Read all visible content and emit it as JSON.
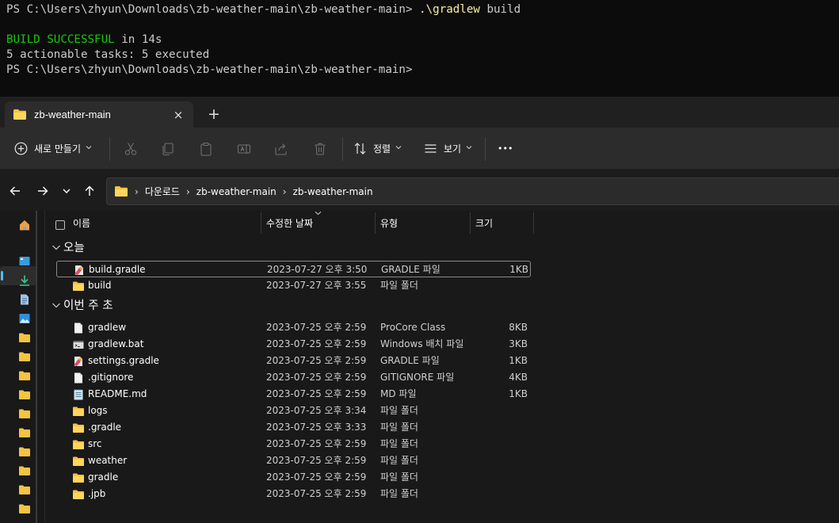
{
  "terminal": {
    "lines": {
      "l1_prompt": "PS C:\\Users\\zhyun\\Downloads\\zb-weather-main\\zb-weather-main> ",
      "l1_cmd": ".\\gradlew",
      "l1_arg": " build",
      "l3_ok": "BUILD SUCCESSFUL",
      "l3_rest": " in 14s",
      "l4": "5 actionable tasks: 5 executed",
      "l5": "PS C:\\Users\\zhyun\\Downloads\\zb-weather-main\\zb-weather-main>"
    }
  },
  "tab": {
    "title": "zb-weather-main",
    "close_icon": "×",
    "new_icon": "+"
  },
  "toolbar": {
    "new_label": "새로 만들기",
    "sort_label": "정렬",
    "view_label": "보기",
    "more_label": "•••",
    "chevron": "⌄"
  },
  "address": {
    "crumbs": [
      "다운로드",
      "zb-weather-main",
      "zb-weather-main"
    ],
    "sep": "›"
  },
  "columns": {
    "name": "이름",
    "date": "수정한 날짜",
    "type": "유형",
    "size": "크기"
  },
  "groups": [
    {
      "title": "오늘",
      "items": [
        {
          "name": "build.gradle",
          "date": "2023-07-27 오후 3:50",
          "type": "GRADLE 파일",
          "size": "1KB",
          "icon": "gradle-file-icon",
          "selected": true
        },
        {
          "name": "build",
          "date": "2023-07-27 오후 3:55",
          "type": "파일 폴더",
          "size": "",
          "icon": "folder-icon"
        }
      ]
    },
    {
      "title": "이번 주 초",
      "items": [
        {
          "name": "gradlew",
          "date": "2023-07-25 오후 2:59",
          "type": "ProCore Class",
          "size": "8KB",
          "icon": "file-icon"
        },
        {
          "name": "gradlew.bat",
          "date": "2023-07-25 오후 2:59",
          "type": "Windows 배치 파일",
          "size": "3KB",
          "icon": "batch-file-icon"
        },
        {
          "name": "settings.gradle",
          "date": "2023-07-25 오후 2:59",
          "type": "GRADLE 파일",
          "size": "1KB",
          "icon": "gradle-file-icon"
        },
        {
          "name": ".gitignore",
          "date": "2023-07-25 오후 2:59",
          "type": "GITIGNORE 파일",
          "size": "4KB",
          "icon": "file-icon"
        },
        {
          "name": "README.md",
          "date": "2023-07-25 오후 2:59",
          "type": "MD 파일",
          "size": "1KB",
          "icon": "notepad-file-icon"
        },
        {
          "name": "logs",
          "date": "2023-07-25 오후 3:34",
          "type": "파일 폴더",
          "size": "",
          "icon": "folder-icon"
        },
        {
          "name": ".gradle",
          "date": "2023-07-25 오후 3:33",
          "type": "파일 폴더",
          "size": "",
          "icon": "folder-icon"
        },
        {
          "name": "src",
          "date": "2023-07-25 오후 2:59",
          "type": "파일 폴더",
          "size": "",
          "icon": "folder-icon"
        },
        {
          "name": "weather",
          "date": "2023-07-25 오후 2:59",
          "type": "파일 폴더",
          "size": "",
          "icon": "folder-icon"
        },
        {
          "name": "gradle",
          "date": "2023-07-25 오후 2:59",
          "type": "파일 폴더",
          "size": "",
          "icon": "folder-icon"
        },
        {
          "name": ".jpb",
          "date": "2023-07-25 오후 2:59",
          "type": "파일 폴더",
          "size": "",
          "icon": "folder-icon"
        }
      ]
    }
  ],
  "colors": {
    "folder": "#f5c342",
    "accent": "#4cc2ff",
    "success": "#16c60c",
    "command": "#f9f1a5"
  }
}
